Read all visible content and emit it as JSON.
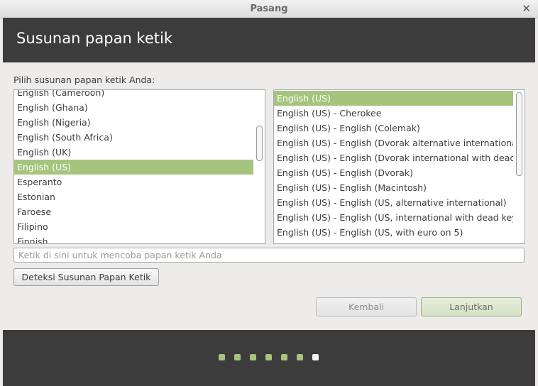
{
  "window": {
    "title": "Pasang",
    "close_glyph": "✕"
  },
  "header": {
    "title": "Susunan papan ketik"
  },
  "prompt": "Pilih susunan papan ketik Anda:",
  "layouts": {
    "items": [
      "English (Cameroon)",
      "English (Ghana)",
      "English (Nigeria)",
      "English (South Africa)",
      "English (UK)",
      "English (US)",
      "Esperanto",
      "Estonian",
      "Faroese",
      "Filipino",
      "Finnish"
    ],
    "selected": "English (US)"
  },
  "variants": {
    "items": [
      "English (US)",
      "English (US) - Cherokee",
      "English (US) - English (Colemak)",
      "English (US) - English (Dvorak alternative international",
      "English (US) - English (Dvorak international with dead k",
      "English (US) - English (Dvorak)",
      "English (US) - English (Macintosh)",
      "English (US) - English (US, alternative international)",
      "English (US) - English (US, international with dead keys",
      "English (US) - English (US, with euro on 5)"
    ],
    "selected": "English (US)"
  },
  "test_input": {
    "placeholder": "Ketik di sini untuk mencoba papan ketik Anda",
    "value": ""
  },
  "buttons": {
    "detect": "Deteksi Susunan Papan Ketik",
    "back": "Kembali",
    "next": "Lanjutkan"
  },
  "progress": {
    "total_steps": 7,
    "current_step": 7
  },
  "colors": {
    "accent": "#a5c57e",
    "header_bg": "#3c3c3c"
  }
}
